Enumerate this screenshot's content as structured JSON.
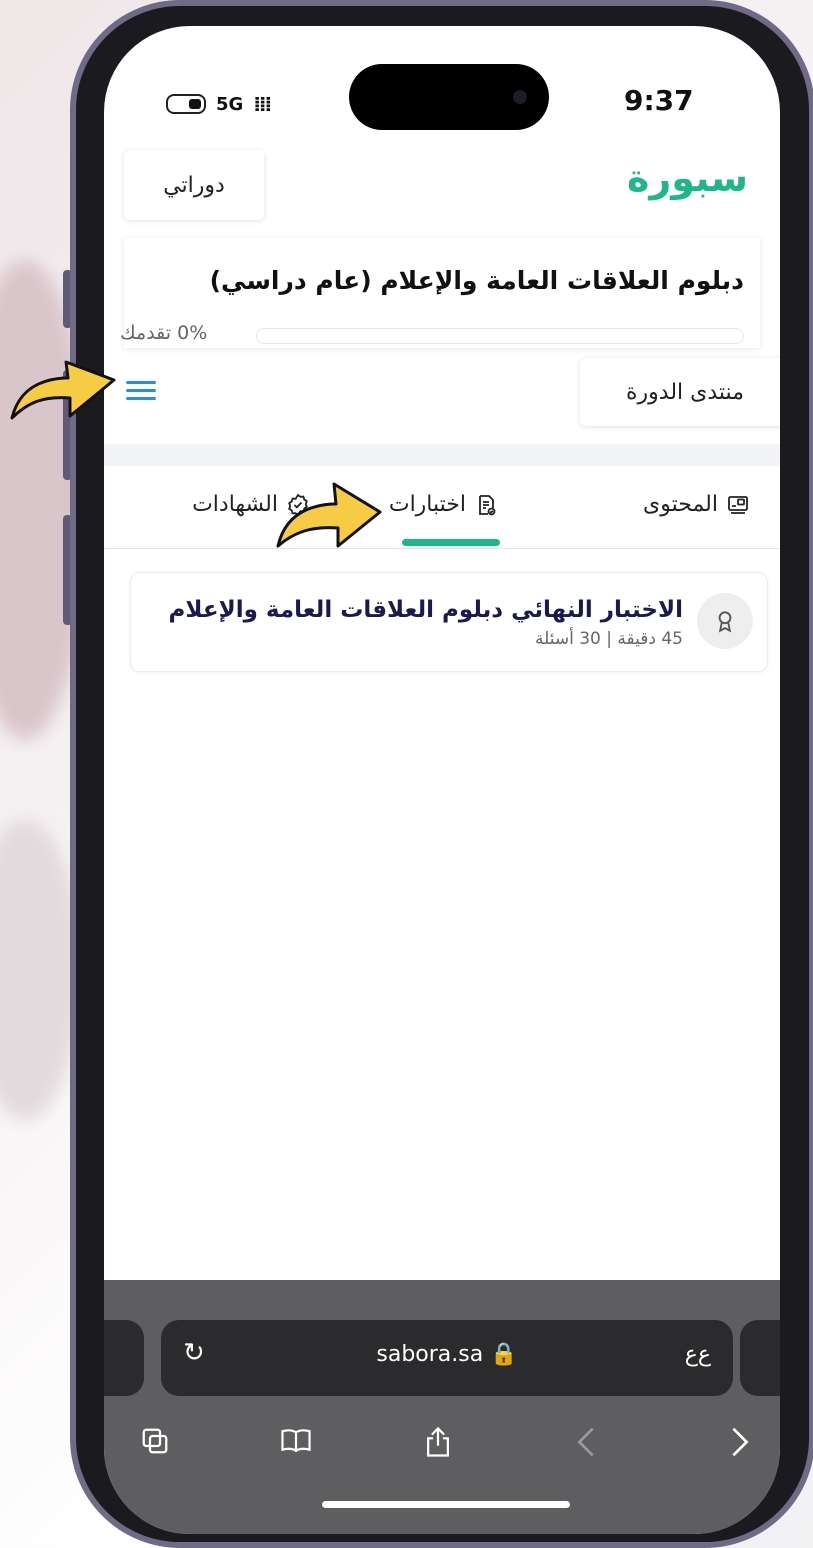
{
  "status_bar": {
    "network": "5G",
    "time": "9:37"
  },
  "header": {
    "brand": "سبورة",
    "my_courses_button": "دوراتي"
  },
  "course": {
    "title": "دبلوم العلاقات العامة والإعلام (عام دراسي)",
    "progress_percent": 0,
    "progress_label": "0% تقدمك",
    "forum_button": "منتدى الدورة"
  },
  "tabs": [
    {
      "label": "المحتوى",
      "icon": "content-icon"
    },
    {
      "label": "اختبارات",
      "icon": "exam-doc-icon",
      "active": true
    },
    {
      "label": "الشهادات",
      "icon": "certificate-badge-icon"
    }
  ],
  "exams": [
    {
      "title": "الاختبار النهائي دبلوم العلاقات العامة والإعلام",
      "meta": "45 دقيقة | 30 أسئلة",
      "icon": "award-icon"
    }
  ],
  "browser": {
    "url": "sabora.sa 🔒",
    "reader_label": "ﻉﻉ",
    "reload_icon": "reload-icon",
    "toolbar_icons": [
      "tabs-icon",
      "bookmarks-icon",
      "share-icon",
      "back-icon",
      "forward-icon"
    ]
  },
  "colors": {
    "brand": "#21b58c",
    "menu": "#2e8fd6",
    "arrow_fill": "#f7cc45",
    "exam_title": "#1b1a4d"
  }
}
